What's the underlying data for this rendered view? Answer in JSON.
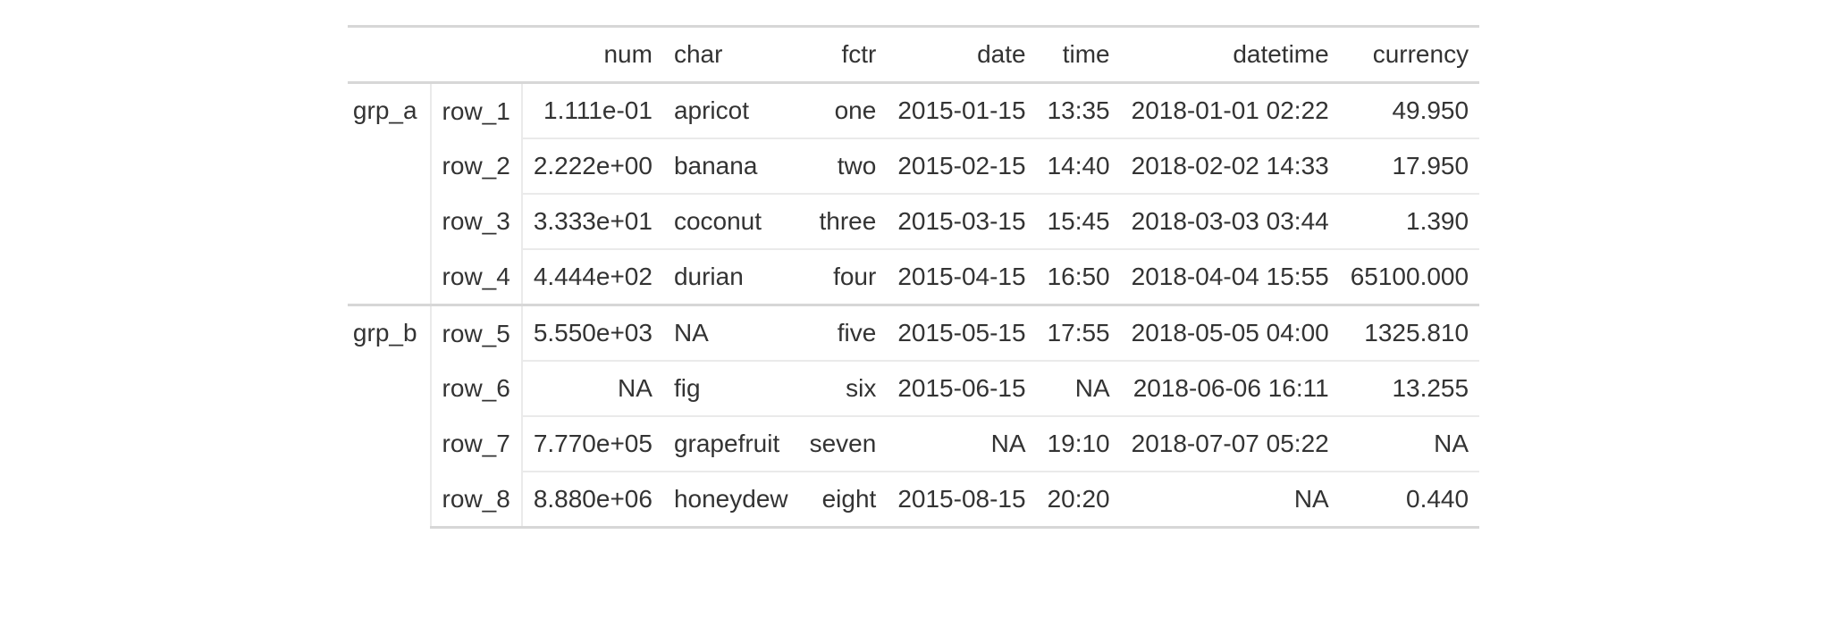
{
  "columns": {
    "num": "num",
    "char": "char",
    "fctr": "fctr",
    "date": "date",
    "time": "time",
    "datetime": "datetime",
    "currency": "currency"
  },
  "groups": [
    {
      "label": "grp_a",
      "rows": [
        {
          "rowname": "row_1",
          "num": "1.111e-01",
          "char": "apricot",
          "fctr": "one",
          "date": "2015-01-15",
          "time": "13:35",
          "datetime": "2018-01-01 02:22",
          "currency": "49.950"
        },
        {
          "rowname": "row_2",
          "num": "2.222e+00",
          "char": "banana",
          "fctr": "two",
          "date": "2015-02-15",
          "time": "14:40",
          "datetime": "2018-02-02 14:33",
          "currency": "17.950"
        },
        {
          "rowname": "row_3",
          "num": "3.333e+01",
          "char": "coconut",
          "fctr": "three",
          "date": "2015-03-15",
          "time": "15:45",
          "datetime": "2018-03-03 03:44",
          "currency": "1.390"
        },
        {
          "rowname": "row_4",
          "num": "4.444e+02",
          "char": "durian",
          "fctr": "four",
          "date": "2015-04-15",
          "time": "16:50",
          "datetime": "2018-04-04 15:55",
          "currency": "65100.000"
        }
      ]
    },
    {
      "label": "grp_b",
      "rows": [
        {
          "rowname": "row_5",
          "num": "5.550e+03",
          "char": "NA",
          "fctr": "five",
          "date": "2015-05-15",
          "time": "17:55",
          "datetime": "2018-05-05 04:00",
          "currency": "1325.810"
        },
        {
          "rowname": "row_6",
          "num": "NA",
          "char": "fig",
          "fctr": "six",
          "date": "2015-06-15",
          "time": "NA",
          "datetime": "2018-06-06 16:11",
          "currency": "13.255"
        },
        {
          "rowname": "row_7",
          "num": "7.770e+05",
          "char": "grapefruit",
          "fctr": "seven",
          "date": "NA",
          "time": "19:10",
          "datetime": "2018-07-07 05:22",
          "currency": "NA"
        },
        {
          "rowname": "row_8",
          "num": "8.880e+06",
          "char": "honeydew",
          "fctr": "eight",
          "date": "2015-08-15",
          "time": "20:20",
          "datetime": "NA",
          "currency": "0.440"
        }
      ]
    }
  ]
}
